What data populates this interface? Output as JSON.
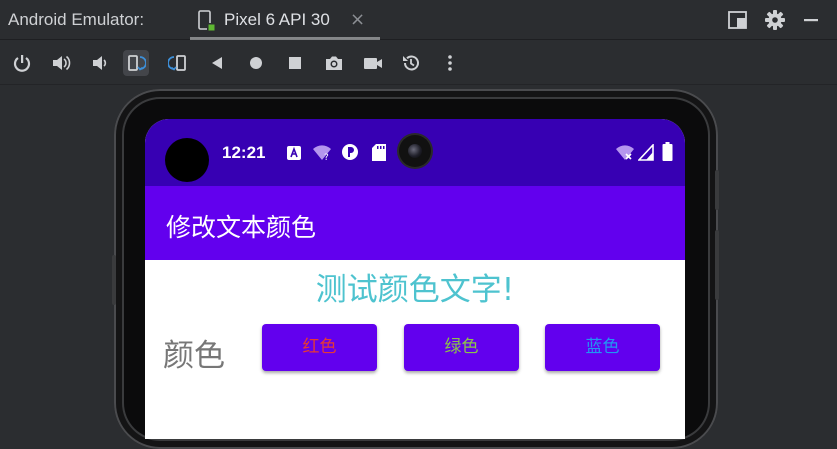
{
  "window": {
    "app_label": "Android Emulator:",
    "tab_label": "Pixel 6 API 30",
    "tab_close": "×"
  },
  "toolbar": {
    "buttons": [
      "power",
      "volume-up",
      "volume-down",
      "rotate-left",
      "rotate-right",
      "back",
      "home",
      "overview",
      "screenshot",
      "screen-record",
      "snapshot",
      "more"
    ]
  },
  "status_bar": {
    "time": "12:21"
  },
  "app": {
    "title": "修改文本颜色",
    "test_text": "测试颜色文字!",
    "color_label": "颜色",
    "buttons": [
      {
        "label": "红色",
        "text_color": "#e53935"
      },
      {
        "label": "绿色",
        "text_color": "#8bc34a"
      },
      {
        "label": "蓝色",
        "text_color": "#2196f3"
      }
    ]
  },
  "colors": {
    "status_bar": "#3700b3",
    "app_bar": "#6200ee",
    "button": "#6200ee",
    "test_text": "#4ec3cf",
    "label_text": "#777777"
  }
}
